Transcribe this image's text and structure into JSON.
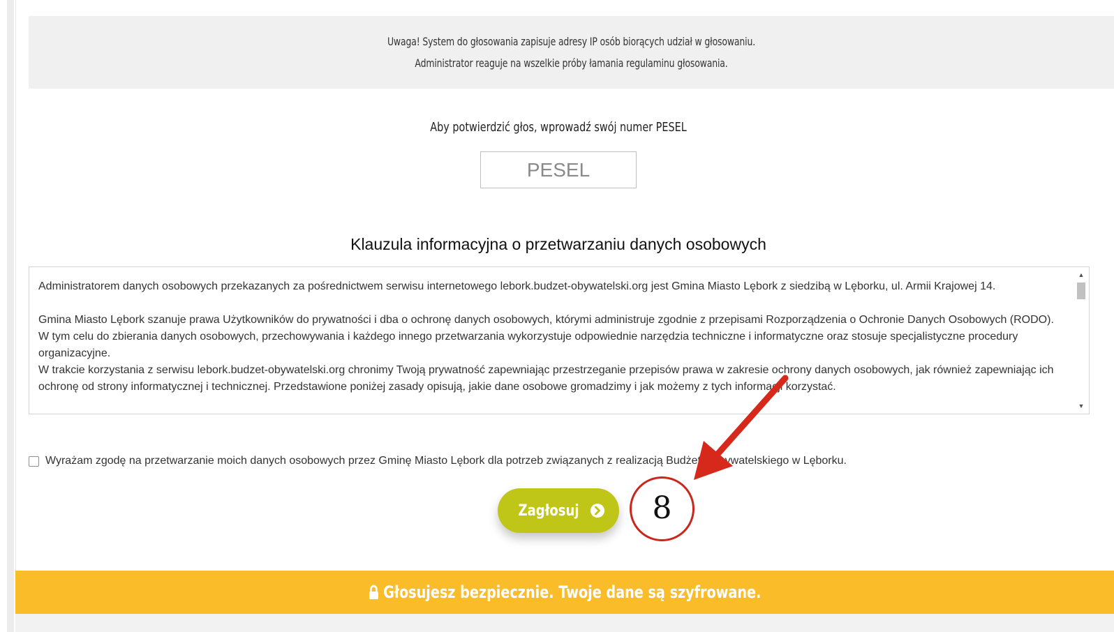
{
  "notice": {
    "line1": "Uwaga! System do głosowania zapisuje adresy IP osób biorących udział w głosowaniu.",
    "line2": "Administrator reaguje na wszelkie próby łamania regulaminu głosowania."
  },
  "pesel": {
    "prompt": "Aby potwierdzić głos, wprowadź swój numer PESEL",
    "placeholder": "PESEL"
  },
  "clause": {
    "heading": "Klauzula informacyjna o przetwarzaniu danych osobowych",
    "paragraph1": "Administratorem danych osobowych przekazanych za pośrednictwem serwisu internetowego lebork.budzet-obywatelski.org jest Gmina Miasto Lębork z siedzibą w Lęborku, ul. Armii Krajowej 14.",
    "paragraph2": "Gmina Miasto Lębork szanuje prawa Użytkowników do prywatności i dba o ochronę danych osobowych, którymi administruje zgodnie z przepisami Rozporządzenia o Ochronie Danych Osobowych (RODO). W tym celu do zbierania danych osobowych, przechowywania i każdego innego przetwarzania wykorzystuje odpowiednie narzędzia techniczne i informatyczne oraz stosuje specjalistyczne procedury organizacyjne.",
    "paragraph3": "W trakcie korzystania z serwisu lebork.budzet-obywatelski.org chronimy Twoją prywatność zapewniając przestrzeganie przepisów prawa w zakresie ochrony danych osobowych, jak również zapewniając ich ochronę od strony informatycznej i technicznej. Przedstawione poniżej zasady opisują, jakie dane osobowe gromadzimy i jak możemy z tych informacji korzystać."
  },
  "consent": {
    "label": "Wyrażam zgodę na przetwarzanie moich danych osobowych przez Gminę Miasto Lębork dla potrzeb związanych z realizacją Budżetu Obywatelskiego w Lęborku.",
    "checked": false
  },
  "vote_button": {
    "label": "Zagłosuj",
    "icon": "chevron-circle-right-icon",
    "color": "#bfc618"
  },
  "annotation": {
    "step_number": "8",
    "color": "#c9261c"
  },
  "secure_bar": {
    "text": "Głosujesz bezpiecznie. Twoje dane są szyfrowane.",
    "icon": "lock-icon",
    "color": "#fbbc2a"
  }
}
